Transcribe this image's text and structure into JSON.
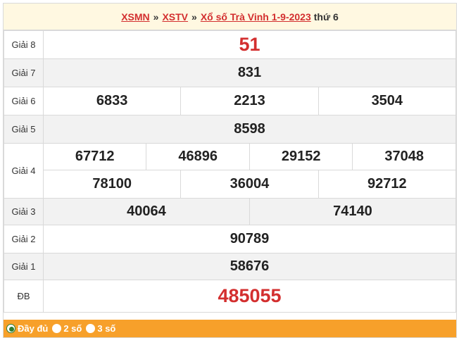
{
  "header": {
    "link1": "XSMN",
    "link2": "XSTV",
    "link3": "Xổ số Trà Vinh 1-9-2023",
    "sep": "»",
    "day": "thứ 6"
  },
  "prizes": {
    "g8": {
      "label": "Giải 8",
      "values": [
        "51"
      ]
    },
    "g7": {
      "label": "Giải 7",
      "values": [
        "831"
      ]
    },
    "g6": {
      "label": "Giải 6",
      "values": [
        "6833",
        "2213",
        "3504"
      ]
    },
    "g5": {
      "label": "Giải 5",
      "values": [
        "8598"
      ]
    },
    "g4": {
      "label": "Giải 4",
      "row1": [
        "67712",
        "46896",
        "29152",
        "37048"
      ],
      "row2": [
        "78100",
        "36004",
        "92712"
      ]
    },
    "g3": {
      "label": "Giải 3",
      "values": [
        "40064",
        "74140"
      ]
    },
    "g2": {
      "label": "Giải 2",
      "values": [
        "90789"
      ]
    },
    "g1": {
      "label": "Giải 1",
      "values": [
        "58676"
      ]
    },
    "db": {
      "label": "ĐB",
      "values": [
        "485055"
      ]
    }
  },
  "footer": {
    "options": [
      "Đầy đủ",
      "2 số",
      "3 số"
    ],
    "selected": "Đầy đủ"
  },
  "colors": {
    "accent_red": "#d32f2f",
    "footer_bg": "#f7a02a",
    "header_bg": "#fff8e1"
  }
}
